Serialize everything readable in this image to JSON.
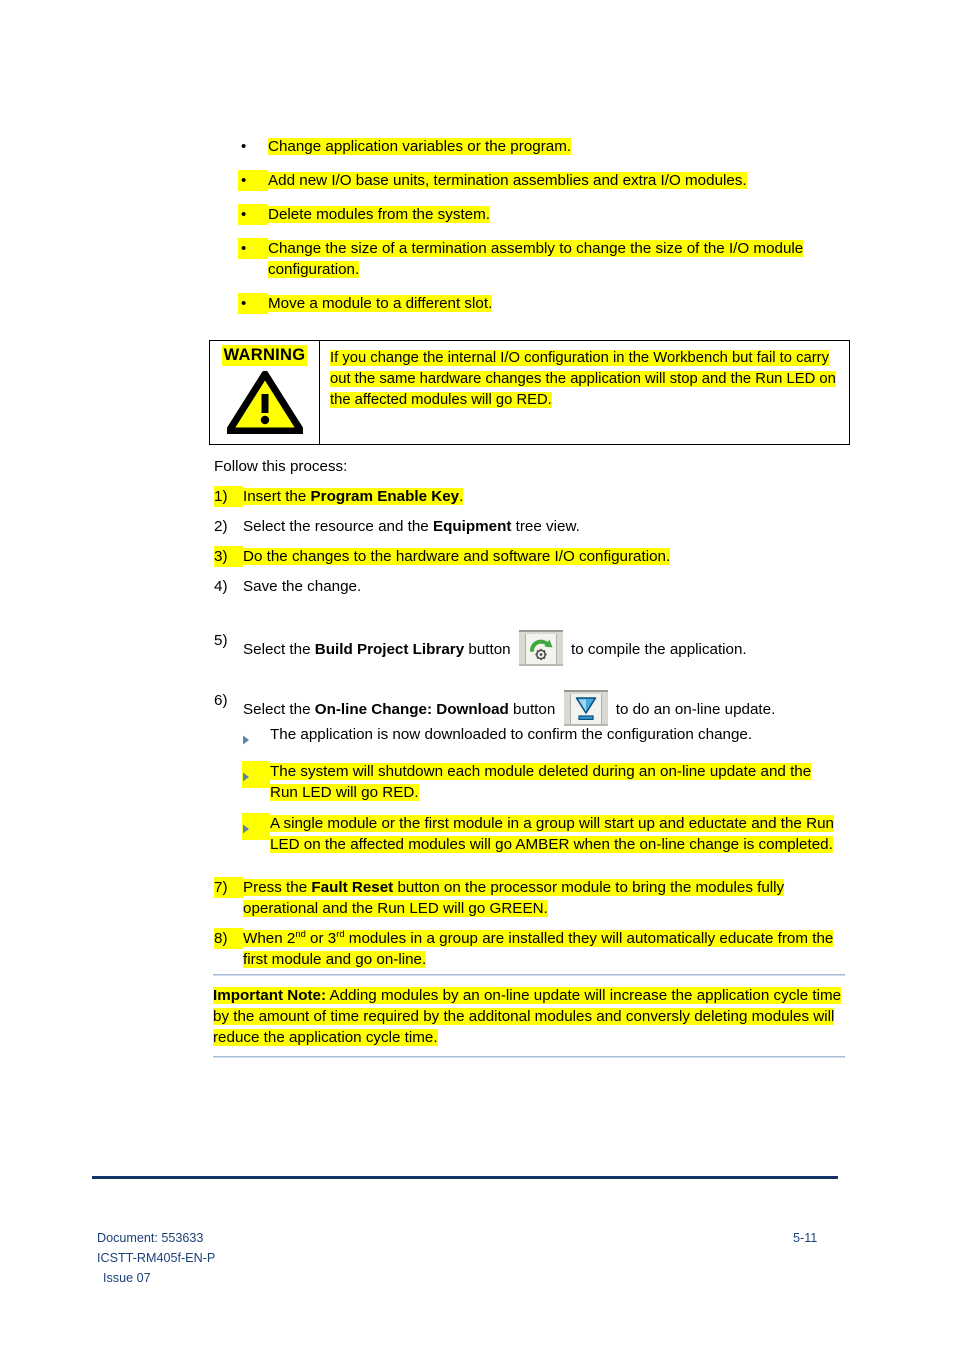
{
  "bullets": [
    {
      "marker": "•",
      "marker_highlighted": false,
      "text": "Change application variables or the program.",
      "highlighted": true
    },
    {
      "marker": "•",
      "marker_highlighted": true,
      "text": "Add new I/O base units, termination assemblies and extra I/O modules.",
      "highlighted": true
    },
    {
      "marker": "•",
      "marker_highlighted": true,
      "text": "Delete modules from the system.",
      "highlighted": true
    },
    {
      "marker": "•",
      "marker_highlighted": true,
      "text": "Change the size of a termination assembly to change the size of the I/O module configuration.",
      "highlighted": true
    },
    {
      "marker": "•",
      "marker_highlighted": true,
      "text": "Move a module to a different slot.",
      "highlighted": true
    }
  ],
  "warning": {
    "label": "WARNING",
    "icon": "warning-triangle-icon",
    "icon_fill": "#ffff00",
    "icon_stroke": "#000000",
    "text": "If you change the internal I/O configuration in the Workbench but fail to carry out the same hardware changes the application will stop and the Run LED on the affected modules will go RED.",
    "highlighted": true
  },
  "follow": {
    "intro": "Follow this process:"
  },
  "steps": [
    {
      "number": "1)",
      "highlighted": true,
      "parts": [
        {
          "t": "Insert the ",
          "bold": false
        },
        {
          "t": "Program Enable Key",
          "bold": true
        },
        {
          "t": ".",
          "bold": false
        }
      ]
    },
    {
      "number": "2)",
      "highlighted": false,
      "parts": [
        {
          "t": "Select the resource and the ",
          "bold": false
        },
        {
          "t": "Equipment",
          "bold": true
        },
        {
          "t": "  tree view.",
          "bold": false
        }
      ]
    },
    {
      "number": "3)",
      "highlighted": true,
      "parts": [
        {
          "t": "Do the changes to the hardware and software I/O configuration.",
          "bold": false
        }
      ]
    },
    {
      "number": "4)",
      "highlighted": false,
      "parts": [
        {
          "t": "Save the change.",
          "bold": false
        }
      ]
    },
    {
      "number": "5)",
      "highlighted": false,
      "icon": "build-project-library-icon",
      "parts": [
        {
          "t": "Select the ",
          "bold": false
        },
        {
          "t": "Build Project Library",
          "bold": true
        },
        {
          "t": " button ",
          "bold": false
        },
        {
          "icon": "build-project-library-icon"
        },
        {
          "t": " to compile the application.",
          "bold": false
        }
      ]
    },
    {
      "number": "6)",
      "highlighted": false,
      "icon": "online-change-download-icon",
      "parts": [
        {
          "t": "Select the ",
          "bold": false
        },
        {
          "t": "On-line Change: Download",
          "bold": true
        },
        {
          "t": " button ",
          "bold": false
        },
        {
          "icon": "online-change-download-icon"
        },
        {
          "t": " to do an on-line update.",
          "bold": false
        }
      ]
    }
  ],
  "substeps": [
    {
      "marker": "▸",
      "marker_color": "#5d82a8",
      "text": "The application is now downloaded to confirm the configuration change.",
      "highlighted": false
    },
    {
      "marker": "▸",
      "marker_color": "#5d82a8",
      "text": "The system will shutdown each module deleted during an on-line update and the Run LED will go RED.",
      "highlighted": true
    },
    {
      "marker": "▸",
      "marker_color": "#5d82a8",
      "text": "A single module or the first module in a group will start up and eductate and the Run LED on the affected modules will go AMBER when the on-line change is completed.",
      "highlighted": true
    }
  ],
  "steps_tail": [
    {
      "number": "7)",
      "highlighted": true,
      "parts": [
        {
          "t": "Press the ",
          "bold": false
        },
        {
          "t": "Fault Reset",
          "bold": true
        },
        {
          "t": " button on the processor module to bring the modules fully operational and the Run LED will go GREEN.",
          "bold": false
        }
      ]
    },
    {
      "number": "8)",
      "highlighted": true,
      "parts": [
        {
          "t": "When 2",
          "bold": false
        },
        {
          "t": "nd",
          "sup": true
        },
        {
          "t": " or 3",
          "bold": false
        },
        {
          "t": "rd",
          "sup": true
        },
        {
          "t": " modules in a group are installed they will automatically educate from the first module and go on-line.",
          "bold": false
        }
      ]
    }
  ],
  "note": {
    "label": "Important Note:",
    "text": " Adding modules by an on-line update will increase the application cycle time by the amount of time required by the additonal modules and conversly deleting modules will reduce the application cycle time.",
    "highlighted": true,
    "rule_color": "#a9c0d6"
  },
  "footer": {
    "document": "Document: 553633",
    "part_number": "ICSTT-RM405f-EN-P",
    "issue": "Issue 07",
    "page": "5-11",
    "rule_color": "#123566",
    "text_color": "#1b4178"
  }
}
